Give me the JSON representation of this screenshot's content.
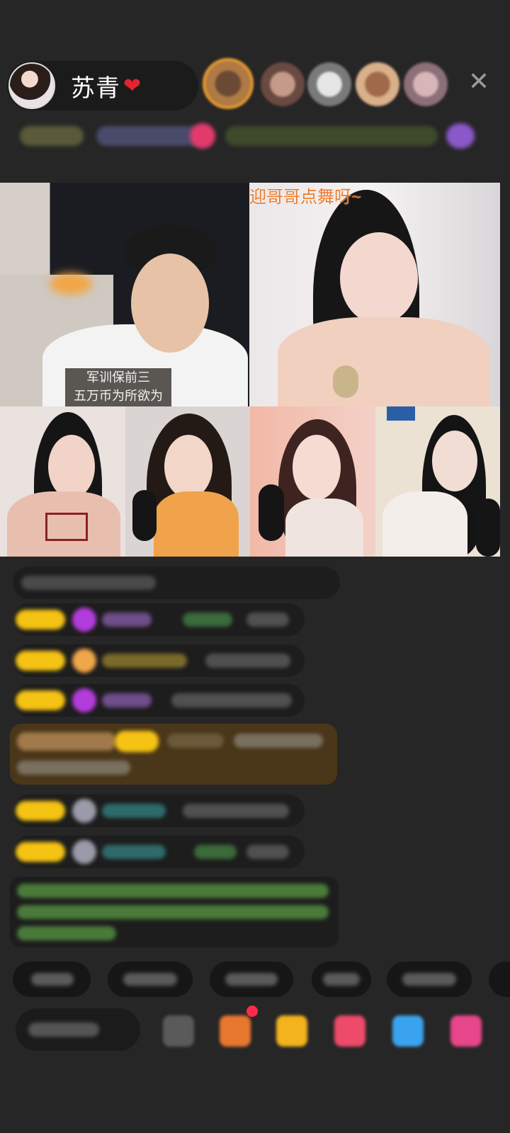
{
  "host": {
    "name": "苏青",
    "heart": "❤"
  },
  "header": {
    "close_glyph": "✕"
  },
  "video": {
    "caption_line1": "军训保前三",
    "caption_line2": "五万币为所欲为",
    "overlay_text": "迎哥哥点舞呀~"
  },
  "colors": {
    "accent_orange": "#e79b2d",
    "badge_yellow": "#f5c314",
    "overlay_text": "#f07b2a",
    "heart_red": "#e52330"
  }
}
